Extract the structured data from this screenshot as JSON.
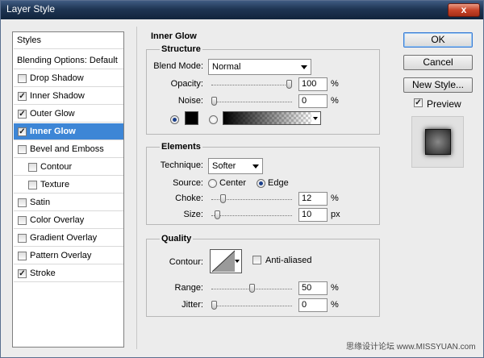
{
  "window": {
    "title": "Layer Style",
    "close_label": "x"
  },
  "styles": {
    "header": "Styles",
    "blending": "Blending Options: Default",
    "items": [
      {
        "label": "Drop Shadow",
        "checked": false,
        "selected": false,
        "sub": false
      },
      {
        "label": "Inner Shadow",
        "checked": true,
        "selected": false,
        "sub": false
      },
      {
        "label": "Outer Glow",
        "checked": true,
        "selected": false,
        "sub": false
      },
      {
        "label": "Inner Glow",
        "checked": true,
        "selected": true,
        "sub": false
      },
      {
        "label": "Bevel and Emboss",
        "checked": false,
        "selected": false,
        "sub": false
      },
      {
        "label": "Contour",
        "checked": false,
        "selected": false,
        "sub": true
      },
      {
        "label": "Texture",
        "checked": false,
        "selected": false,
        "sub": true
      },
      {
        "label": "Satin",
        "checked": false,
        "selected": false,
        "sub": false
      },
      {
        "label": "Color Overlay",
        "checked": false,
        "selected": false,
        "sub": false
      },
      {
        "label": "Gradient Overlay",
        "checked": false,
        "selected": false,
        "sub": false
      },
      {
        "label": "Pattern Overlay",
        "checked": false,
        "selected": false,
        "sub": false
      },
      {
        "label": "Stroke",
        "checked": true,
        "selected": false,
        "sub": false
      }
    ]
  },
  "panel": {
    "title": "Inner Glow",
    "structure": {
      "heading": "Structure",
      "blend_mode_label": "Blend Mode:",
      "blend_mode_value": "Normal",
      "opacity_label": "Opacity:",
      "opacity_value": "100",
      "opacity_level": 1.0,
      "opacity_unit": "%",
      "noise_label": "Noise:",
      "noise_value": "0",
      "noise_level": 0.0,
      "noise_unit": "%",
      "color_swatch": "#000000"
    },
    "elements": {
      "heading": "Elements",
      "technique_label": "Technique:",
      "technique_value": "Softer",
      "source_label": "Source:",
      "source_center": "Center",
      "source_edge": "Edge",
      "choke_label": "Choke:",
      "choke_value": "12",
      "choke_level": 0.12,
      "choke_unit": "%",
      "size_label": "Size:",
      "size_value": "10",
      "size_level": 0.04,
      "size_unit": "px"
    },
    "quality": {
      "heading": "Quality",
      "contour_label": "Contour:",
      "anti_aliased_label": "Anti-aliased",
      "range_label": "Range:",
      "range_value": "50",
      "range_level": 0.5,
      "range_unit": "%",
      "jitter_label": "Jitter:",
      "jitter_value": "0",
      "jitter_level": 0.0,
      "jitter_unit": "%"
    }
  },
  "buttons": {
    "ok": "OK",
    "cancel": "Cancel",
    "new_style": "New Style..."
  },
  "preview": {
    "label": "Preview",
    "checked": true
  },
  "watermark": "思缘设计论坛  www.MISSYUAN.com",
  "colors": {
    "selection": "#3d86d6",
    "titlebar": "#1e3553",
    "close": "#c8452a"
  }
}
